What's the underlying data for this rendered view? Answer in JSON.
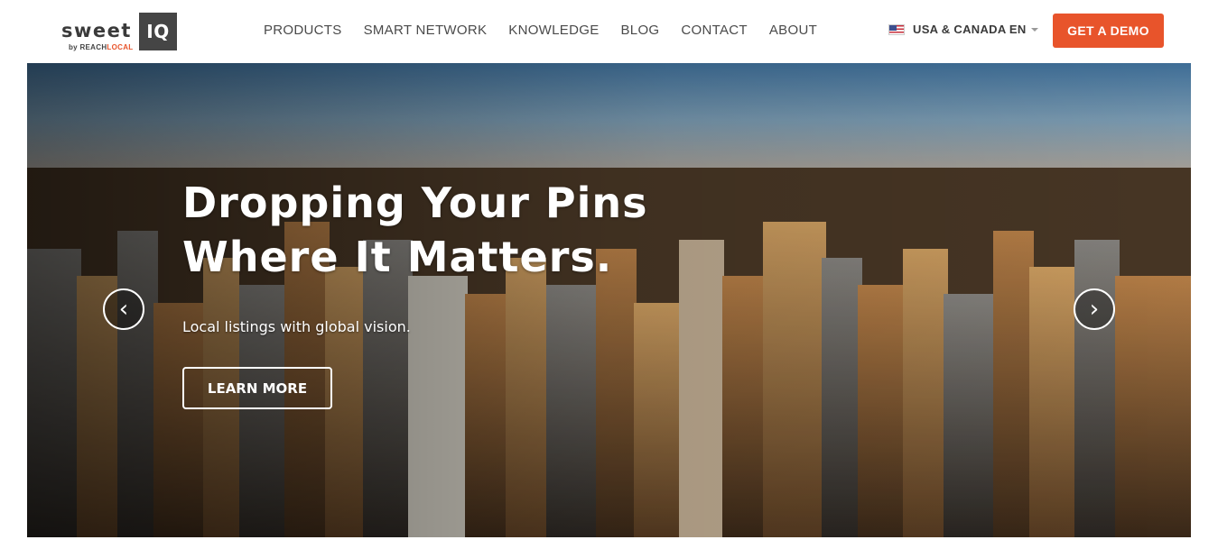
{
  "logo": {
    "word": "sweet",
    "box": "IQ",
    "by": "by ",
    "by_brand_a": "REACH",
    "by_brand_b": "LOCAL"
  },
  "nav": {
    "items": [
      {
        "label": "PRODUCTS"
      },
      {
        "label": "SMART NETWORK"
      },
      {
        "label": "KNOWLEDGE"
      },
      {
        "label": "BLOG"
      },
      {
        "label": "CONTACT"
      },
      {
        "label": "ABOUT"
      }
    ]
  },
  "region": {
    "flag_icon": "us-flag-icon",
    "label": "USA & CANADA EN",
    "caret_icon": "chevron-down-icon"
  },
  "demo": {
    "label": "GET A DEMO"
  },
  "hero": {
    "title_line1": "Dropping Your Pins",
    "title_line2": "Where It Matters.",
    "subtitle": "Local listings with global vision.",
    "cta": "LEARN MORE",
    "prev_icon": "chevron-left-icon",
    "next_icon": "chevron-right-icon",
    "prev_glyph": "‹",
    "next_glyph": "›"
  },
  "colors": {
    "accent": "#e8542b",
    "logo_box": "#454545",
    "nav_text": "#4a4a4a"
  }
}
